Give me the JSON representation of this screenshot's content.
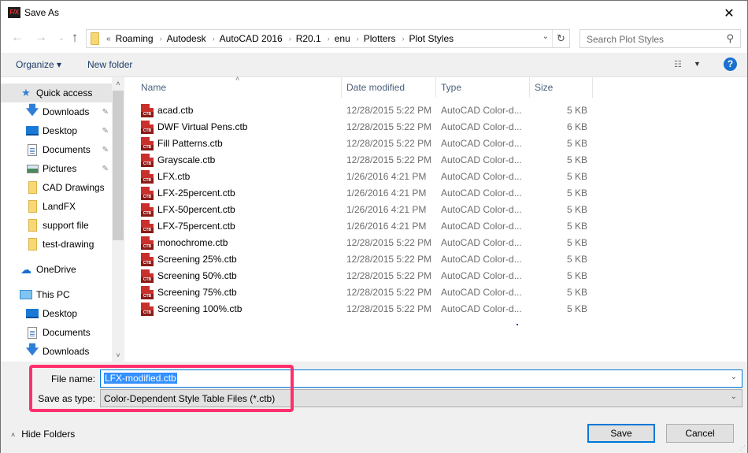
{
  "window": {
    "title": "Save As",
    "app_icon_text": "F/X",
    "close_glyph": "✕"
  },
  "nav": {
    "back_glyph": "←",
    "forward_glyph": "→",
    "recent_glyph": "⌄",
    "up_glyph": "↑",
    "breadcrumb_overflow": "«",
    "breadcrumbs": [
      "Roaming",
      "Autodesk",
      "AutoCAD 2016",
      "R20.1",
      "enu",
      "Plotters",
      "Plot Styles"
    ],
    "separator": "›",
    "dropdown_glyph": "⌄",
    "refresh_glyph": "↻",
    "search_placeholder": "Search Plot Styles",
    "search_icon": "⚲"
  },
  "toolbar": {
    "organize_label": "Organize ▾",
    "new_folder_label": "New folder",
    "view_glyph": "☷",
    "view_caret": "▼",
    "help_glyph": "?"
  },
  "sidebar": {
    "items": [
      {
        "label": "Quick access",
        "icon": "star-icon",
        "pinned": false,
        "selected": true
      },
      {
        "label": "Downloads",
        "icon": "download-icon",
        "pinned": true
      },
      {
        "label": "Desktop",
        "icon": "desktop-icon",
        "pinned": true
      },
      {
        "label": "Documents",
        "icon": "documents-icon",
        "pinned": true
      },
      {
        "label": "Pictures",
        "icon": "pictures-icon",
        "pinned": true
      },
      {
        "label": "CAD Drawings",
        "icon": "folder-icon",
        "pinned": false
      },
      {
        "label": "LandFX",
        "icon": "folder-icon",
        "pinned": false
      },
      {
        "label": "support file",
        "icon": "folder-icon",
        "pinned": false
      },
      {
        "label": "test-drawing",
        "icon": "folder-icon",
        "pinned": false
      },
      {
        "label": "OneDrive",
        "icon": "cloud-icon",
        "pinned": false
      },
      {
        "label": "This PC",
        "icon": "computer-icon",
        "pinned": false
      },
      {
        "label": "Desktop",
        "icon": "desktop-icon",
        "pinned": false
      },
      {
        "label": "Documents",
        "icon": "documents-icon",
        "pinned": false
      },
      {
        "label": "Downloads",
        "icon": "download-icon",
        "pinned": false
      }
    ],
    "pin_glyph": "📌",
    "scroll_up_glyph": "˄",
    "scroll_down_glyph": "˅"
  },
  "filelist": {
    "sort_glyph": "˄",
    "columns": [
      "Name",
      "Date modified",
      "Type",
      "Size"
    ],
    "icon_label": "CTB",
    "rows": [
      {
        "name": "acad.ctb",
        "date": "12/28/2015 5:22 PM",
        "type": "AutoCAD Color-d...",
        "size": "5 KB"
      },
      {
        "name": "DWF Virtual Pens.ctb",
        "date": "12/28/2015 5:22 PM",
        "type": "AutoCAD Color-d...",
        "size": "6 KB"
      },
      {
        "name": "Fill Patterns.ctb",
        "date": "12/28/2015 5:22 PM",
        "type": "AutoCAD Color-d...",
        "size": "5 KB"
      },
      {
        "name": "Grayscale.ctb",
        "date": "12/28/2015 5:22 PM",
        "type": "AutoCAD Color-d...",
        "size": "5 KB"
      },
      {
        "name": "LFX.ctb",
        "date": "1/26/2016 4:21 PM",
        "type": "AutoCAD Color-d...",
        "size": "5 KB"
      },
      {
        "name": "LFX-25percent.ctb",
        "date": "1/26/2016 4:21 PM",
        "type": "AutoCAD Color-d...",
        "size": "5 KB"
      },
      {
        "name": "LFX-50percent.ctb",
        "date": "1/26/2016 4:21 PM",
        "type": "AutoCAD Color-d...",
        "size": "5 KB"
      },
      {
        "name": "LFX-75percent.ctb",
        "date": "1/26/2016 4:21 PM",
        "type": "AutoCAD Color-d...",
        "size": "5 KB"
      },
      {
        "name": "monochrome.ctb",
        "date": "12/28/2015 5:22 PM",
        "type": "AutoCAD Color-d...",
        "size": "5 KB"
      },
      {
        "name": "Screening 25%.ctb",
        "date": "12/28/2015 5:22 PM",
        "type": "AutoCAD Color-d...",
        "size": "5 KB"
      },
      {
        "name": "Screening 50%.ctb",
        "date": "12/28/2015 5:22 PM",
        "type": "AutoCAD Color-d...",
        "size": "5 KB"
      },
      {
        "name": "Screening 75%.ctb",
        "date": "12/28/2015 5:22 PM",
        "type": "AutoCAD Color-d...",
        "size": "5 KB"
      },
      {
        "name": "Screening 100%.ctb",
        "date": "12/28/2015 5:22 PM",
        "type": "AutoCAD Color-d...",
        "size": "5 KB"
      }
    ]
  },
  "form": {
    "file_name_label": "File name:",
    "file_name_value": "LFX-modified.ctb",
    "save_as_type_label": "Save as type:",
    "save_as_type_value": "Color-Dependent Style Table Files (*.ctb)",
    "dropdown_glyph": "⌄",
    "highlight_color": "#ff2f6d"
  },
  "footer": {
    "hide_folders_glyph": "˄",
    "hide_folders_label": "Hide Folders",
    "save_label": "Save",
    "cancel_label": "Cancel"
  }
}
